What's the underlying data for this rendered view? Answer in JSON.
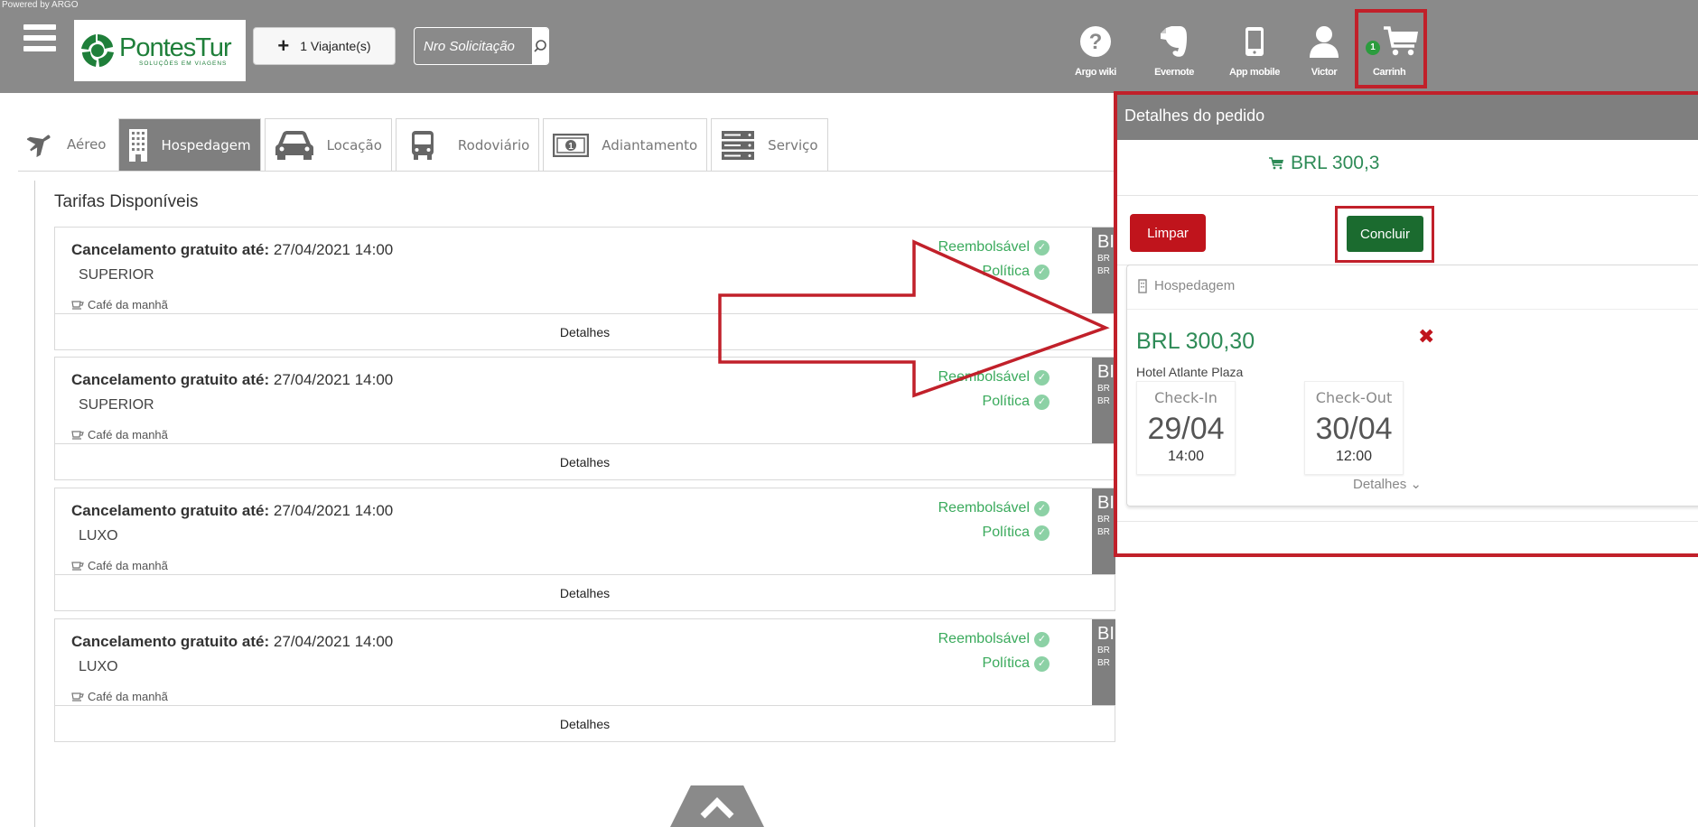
{
  "header": {
    "powered_by": "Powered by ARGO",
    "logo_name": "PontesTur",
    "logo_tagline": "SOLUÇÕES EM VIAGENS",
    "traveler_button": "1 Viajante(s)",
    "search_placeholder": "Nro Solicitação",
    "nav": [
      {
        "label": "Argo wiki",
        "icon": "help-circle-icon"
      },
      {
        "label": "Evernote",
        "icon": "evernote-icon"
      },
      {
        "label": "App mobile",
        "icon": "mobile-phone-icon"
      },
      {
        "label": "Victor",
        "icon": "user-icon"
      },
      {
        "label": "Carrinh",
        "icon": "cart-icon",
        "badge": "1"
      }
    ]
  },
  "tabs": [
    {
      "label": "Aéreo",
      "icon": "airplane-icon",
      "active": false
    },
    {
      "label": "Hospedagem",
      "icon": "building-icon",
      "active": true
    },
    {
      "label": "Locação",
      "icon": "car-icon",
      "active": false
    },
    {
      "label": "Rodoviário",
      "icon": "bus-icon",
      "active": false
    },
    {
      "label": "Adiantamento",
      "icon": "cash-icon",
      "active": false
    },
    {
      "label": "Serviço",
      "icon": "service-icon",
      "active": false
    }
  ],
  "content": {
    "title": "Tarifas Disponíveis",
    "rates": [
      {
        "cancel_label": "Cancelamento gratuito até:",
        "cancel_date": "27/04/2021 14:00",
        "room": "SUPERIOR",
        "meal": "Café da manhã",
        "refund": "Reembolsável",
        "policy": "Política",
        "price_head": "BI",
        "price_l1": "BR",
        "price_l2": "BR",
        "details": "Detalhes"
      },
      {
        "cancel_label": "Cancelamento gratuito até:",
        "cancel_date": "27/04/2021 14:00",
        "room": "SUPERIOR",
        "meal": "Café da manhã",
        "refund": "Reembolsável",
        "policy": "Política",
        "price_head": "BI",
        "price_l1": "BR",
        "price_l2": "BR",
        "details": "Detalhes"
      },
      {
        "cancel_label": "Cancelamento gratuito até:",
        "cancel_date": "27/04/2021 14:00",
        "room": "LUXO",
        "meal": "Café da manhã",
        "refund": "Reembolsável",
        "policy": "Política",
        "price_head": "BI",
        "price_l1": "BR",
        "price_l2": "BR",
        "details": "Detalhes"
      },
      {
        "cancel_label": "Cancelamento gratuito até:",
        "cancel_date": "27/04/2021 14:00",
        "room": "LUXO",
        "meal": "Café da manhã",
        "refund": "Reembolsável",
        "policy": "Política",
        "price_head": "BI",
        "price_l1": "BR",
        "price_l2": "BR",
        "details": "Detalhes"
      }
    ]
  },
  "panel": {
    "title": "Detalhes do pedido",
    "total": "BRL 300,3",
    "clear_button": "Limpar",
    "finish_button": "Concluir",
    "item": {
      "type": "Hospedagem",
      "price": "BRL 300,30",
      "remove": "✖",
      "hotel": "Hotel Atlante Plaza",
      "checkin_label": "Check-In",
      "checkin_date": "29/04",
      "checkin_time": "14:00",
      "checkout_label": "Check-Out",
      "checkout_date": "30/04",
      "checkout_time": "12:00",
      "details": "Detalhes ⌄"
    }
  },
  "colors": {
    "topbar": "#8a8a8a",
    "brand_green": "#1f7f3a",
    "price_green": "#2e8b57",
    "ok_green": "#3aaa5c",
    "danger_red": "#c0141c",
    "highlight_red": "#c1202a",
    "finish_green": "#1b6b2f"
  }
}
